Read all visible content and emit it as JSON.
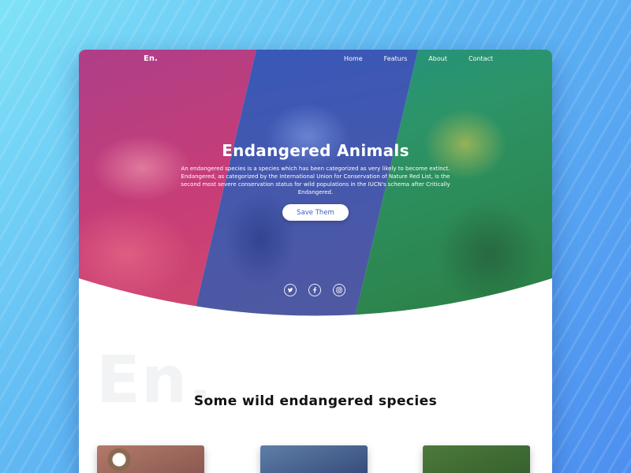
{
  "site": {
    "logo": "En.",
    "watermark": "En."
  },
  "nav": {
    "items": [
      {
        "label": "Home"
      },
      {
        "label": "Featurs"
      },
      {
        "label": "About"
      },
      {
        "label": "Contact"
      }
    ]
  },
  "hero": {
    "title": "Endangered Animals",
    "description": "An endangered species is a species which has been categorized as very likely to become extinct. Endangered, as categorized by the International Union for Conservation of Nature Red List, is the second most severe conservation status for wild populations in the IUCN's schema after Critically Endangered.",
    "cta_label": "Save Them",
    "panels": [
      {
        "icon": "lizard-photo",
        "tint": "#d8408a"
      },
      {
        "icon": "vulture-photo",
        "tint": "#3f5fc0"
      },
      {
        "icon": "red-panda-photo",
        "tint": "#2ea35a"
      }
    ]
  },
  "social": {
    "icons": [
      "twitter-icon",
      "facebook-icon",
      "instagram-icon"
    ]
  },
  "species": {
    "title": "Some wild endangered species",
    "cards": [
      {
        "icon": "eagle-photo"
      },
      {
        "icon": "blue-bird-photo"
      },
      {
        "icon": "green-animal-photo"
      }
    ]
  },
  "colors": {
    "background": "#5fb6f3",
    "accent": "#3b5fc0",
    "pink": "#d8408a",
    "green": "#2ea35a"
  }
}
